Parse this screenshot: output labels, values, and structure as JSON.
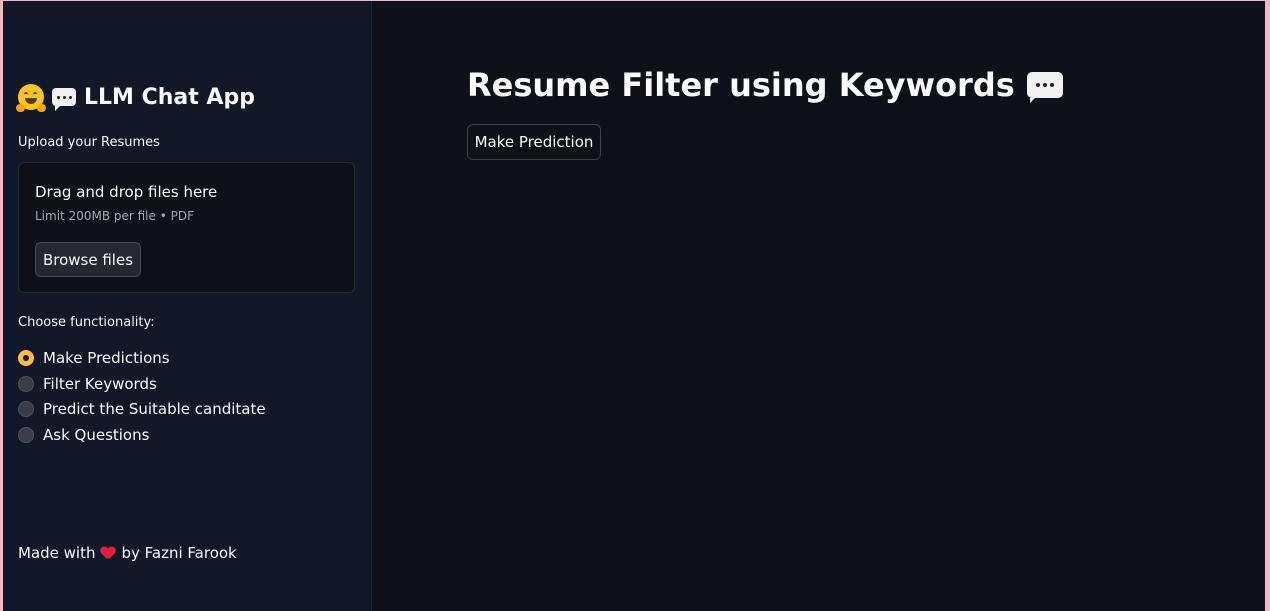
{
  "sidebar": {
    "title": "LLM Chat App",
    "upload_label": "Upload your Resumes",
    "dropzone": {
      "primary": "Drag and drop files here",
      "secondary": "Limit 200MB per file • PDF",
      "browse_label": "Browse files"
    },
    "func_label": "Choose functionality:",
    "options": [
      {
        "label": "Make Predictions",
        "selected": true
      },
      {
        "label": "Filter Keywords",
        "selected": false
      },
      {
        "label": "Predict the Suitable canditate",
        "selected": false
      },
      {
        "label": "Ask Questions",
        "selected": false
      }
    ],
    "footer": {
      "prefix": "Made with",
      "suffix": "by Fazni Farook"
    }
  },
  "main": {
    "title": "Resume Filter using Keywords",
    "button_label": "Make Prediction"
  },
  "colors": {
    "accent": "#ffbd45",
    "background": "#0e1117",
    "sidebar": "#111827",
    "heart": "#e0203a"
  }
}
